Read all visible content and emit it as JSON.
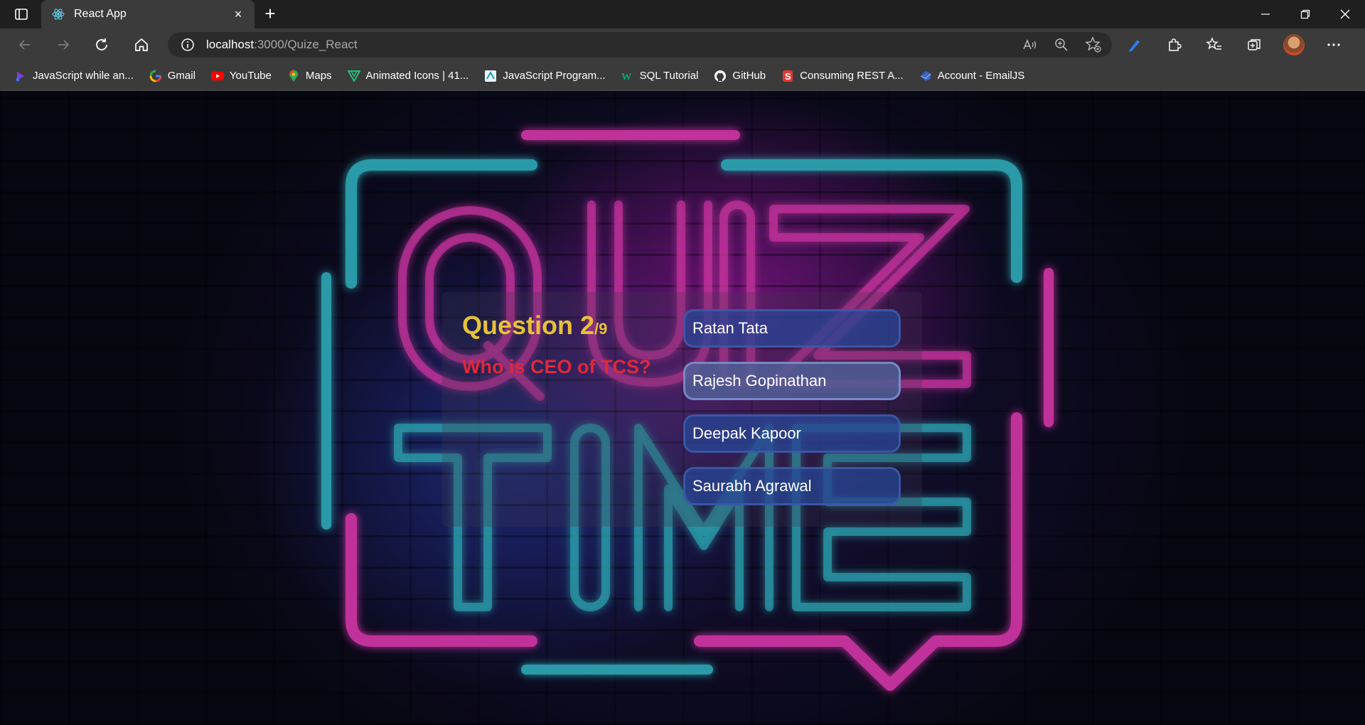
{
  "browser": {
    "tab_title": "React App",
    "url_host": "localhost",
    "url_path": ":3000/Quize_React"
  },
  "bookmarks": [
    {
      "label": "JavaScript while an...",
      "icon": "js-bookmark-icon"
    },
    {
      "label": "Gmail",
      "icon": "google-icon"
    },
    {
      "label": "YouTube",
      "icon": "youtube-icon"
    },
    {
      "label": "Maps",
      "icon": "maps-icon"
    },
    {
      "label": "Animated Icons | 41...",
      "icon": "animated-icons-icon"
    },
    {
      "label": "JavaScript Program...",
      "icon": "js-program-icon"
    },
    {
      "label": "SQL Tutorial",
      "icon": "w3schools-icon"
    },
    {
      "label": "GitHub",
      "icon": "github-icon"
    },
    {
      "label": "Consuming REST A...",
      "icon": "rest-icon"
    },
    {
      "label": "Account - EmailJS",
      "icon": "emailjs-icon"
    }
  ],
  "quiz": {
    "question_label": "Question 2",
    "question_total": "/9",
    "question_text": "Who is CEO of TCS?",
    "answers": [
      "Ratan Tata",
      "Rajesh Gopinathan",
      "Deepak Kapoor",
      "Saurabh Agrawal"
    ]
  },
  "colors": {
    "question_count": "#e6c23a",
    "question_text": "#e0283a",
    "neon_pink": "#c0309a",
    "neon_teal": "#2a9aa8"
  }
}
